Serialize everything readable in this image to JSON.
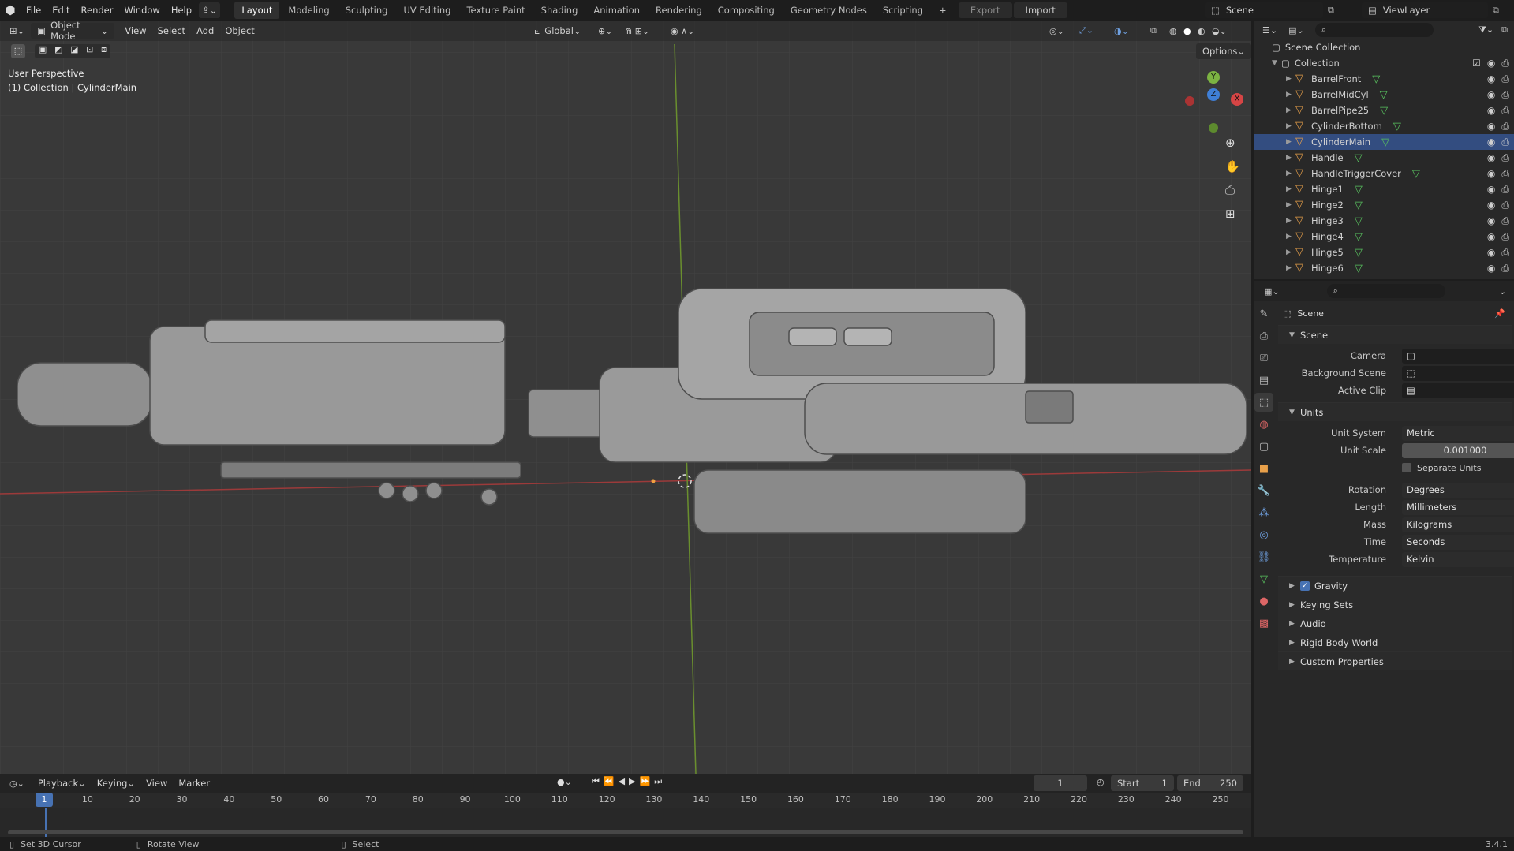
{
  "topbar": {
    "menus": [
      "File",
      "Edit",
      "Render",
      "Window",
      "Help"
    ],
    "workspaces": [
      "Layout",
      "Modeling",
      "Sculpting",
      "UV Editing",
      "Texture Paint",
      "Shading",
      "Animation",
      "Rendering",
      "Compositing",
      "Geometry Nodes",
      "Scripting"
    ],
    "active_workspace": "Layout",
    "export_label": "Export",
    "import_label": "Import",
    "scene_name": "Scene",
    "view_layer": "ViewLayer"
  },
  "viewport": {
    "mode": "Object Mode",
    "menus": [
      "View",
      "Select",
      "Add",
      "Object"
    ],
    "orientation": "Global",
    "options_label": "Options",
    "perspective_label": "User Perspective",
    "active_label": "(1) Collection | CylinderMain",
    "gizmo": {
      "x": "X",
      "y": "Y",
      "z": "Z"
    }
  },
  "outliner": {
    "root": "Scene Collection",
    "collection": "Collection",
    "objects": [
      "BarrelFront",
      "BarrelMidCyl",
      "BarrelPipe25",
      "CylinderBottom",
      "CylinderMain",
      "Handle",
      "HandleTriggerCover",
      "Hinge1",
      "Hinge2",
      "Hinge3",
      "Hinge4",
      "Hinge5",
      "Hinge6"
    ],
    "active_object": "CylinderMain"
  },
  "properties": {
    "context": "Scene",
    "scene_panel": {
      "title": "Scene",
      "camera_label": "Camera",
      "background_label": "Background Scene",
      "clip_label": "Active Clip"
    },
    "units_panel": {
      "title": "Units",
      "unit_system_label": "Unit System",
      "unit_system": "Metric",
      "unit_scale_label": "Unit Scale",
      "unit_scale": "0.001000",
      "separate_units": "Separate Units",
      "rotation_label": "Rotation",
      "rotation": "Degrees",
      "length_label": "Length",
      "length": "Millimeters",
      "mass_label": "Mass",
      "mass": "Kilograms",
      "time_label": "Time",
      "time": "Seconds",
      "temperature_label": "Temperature",
      "temperature": "Kelvin"
    },
    "collapsed_panels": [
      "Gravity",
      "Keying Sets",
      "Audio",
      "Rigid Body World",
      "Custom Properties"
    ]
  },
  "timeline": {
    "menus": [
      "Playback",
      "Keying",
      "View",
      "Marker"
    ],
    "current_frame": "1",
    "start_label": "Start",
    "start": "1",
    "end_label": "End",
    "end": "250",
    "ticks": [
      "1",
      "10",
      "20",
      "30",
      "40",
      "50",
      "60",
      "70",
      "80",
      "90",
      "100",
      "110",
      "120",
      "130",
      "140",
      "150",
      "160",
      "170",
      "180",
      "190",
      "200",
      "210",
      "220",
      "230",
      "240",
      "250"
    ]
  },
  "statusbar": {
    "left": "Set 3D Cursor",
    "middle": "Rotate View",
    "right": "Select",
    "version": "3.4.1"
  },
  "colors": {
    "accent": "#4772b3",
    "x_axis": "#d64545",
    "y_axis": "#7cb342",
    "z_axis": "#3f7fd6",
    "mesh_green": "#59c35f",
    "object_orange": "#e8a04a"
  }
}
